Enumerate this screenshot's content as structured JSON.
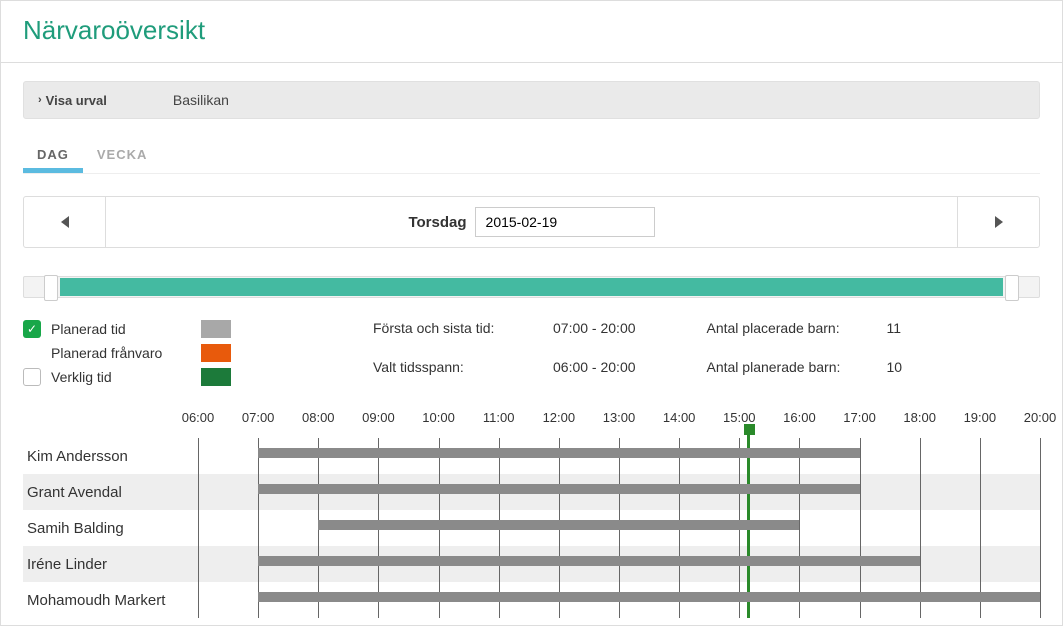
{
  "title": "Närvaroöversikt",
  "filter": {
    "toggle": "Visa urval",
    "name": "Basilikan"
  },
  "tabs": {
    "day": "DAG",
    "week": "VECKA",
    "active": 0
  },
  "date": {
    "dayName": "Torsdag",
    "value": "2015-02-19"
  },
  "legend": {
    "planned": "Planerad tid",
    "plannedAbs": "Planerad frånvaro",
    "actual": "Verklig tid"
  },
  "info": {
    "label1": "Första och sista tid:",
    "val1": "07:00 - 20:00",
    "label2": "Valt tidsspann:",
    "val2": "06:00 - 20:00",
    "label3": "Antal placerade barn:",
    "val3": "11",
    "label4": "Antal planerade barn:",
    "val4": "10"
  },
  "chart_data": {
    "type": "gantt",
    "time_start": 6,
    "time_end": 20,
    "time_ticks": [
      "06:00",
      "07:00",
      "08:00",
      "09:00",
      "10:00",
      "11:00",
      "12:00",
      "13:00",
      "14:00",
      "15:00",
      "16:00",
      "17:00",
      "18:00",
      "19:00",
      "20:00"
    ],
    "now": 15.15,
    "rows": [
      {
        "name": "Kim Andersson",
        "alt": false,
        "start": 7,
        "end": 17
      },
      {
        "name": "Grant Avendal",
        "alt": true,
        "start": 7,
        "end": 17
      },
      {
        "name": "Samih Balding",
        "alt": false,
        "start": 8,
        "end": 16
      },
      {
        "name": "Iréne Linder",
        "alt": true,
        "start": 7,
        "end": 18
      },
      {
        "name": "Mohamoudh Markert",
        "alt": false,
        "start": 7,
        "end": 20
      }
    ]
  }
}
